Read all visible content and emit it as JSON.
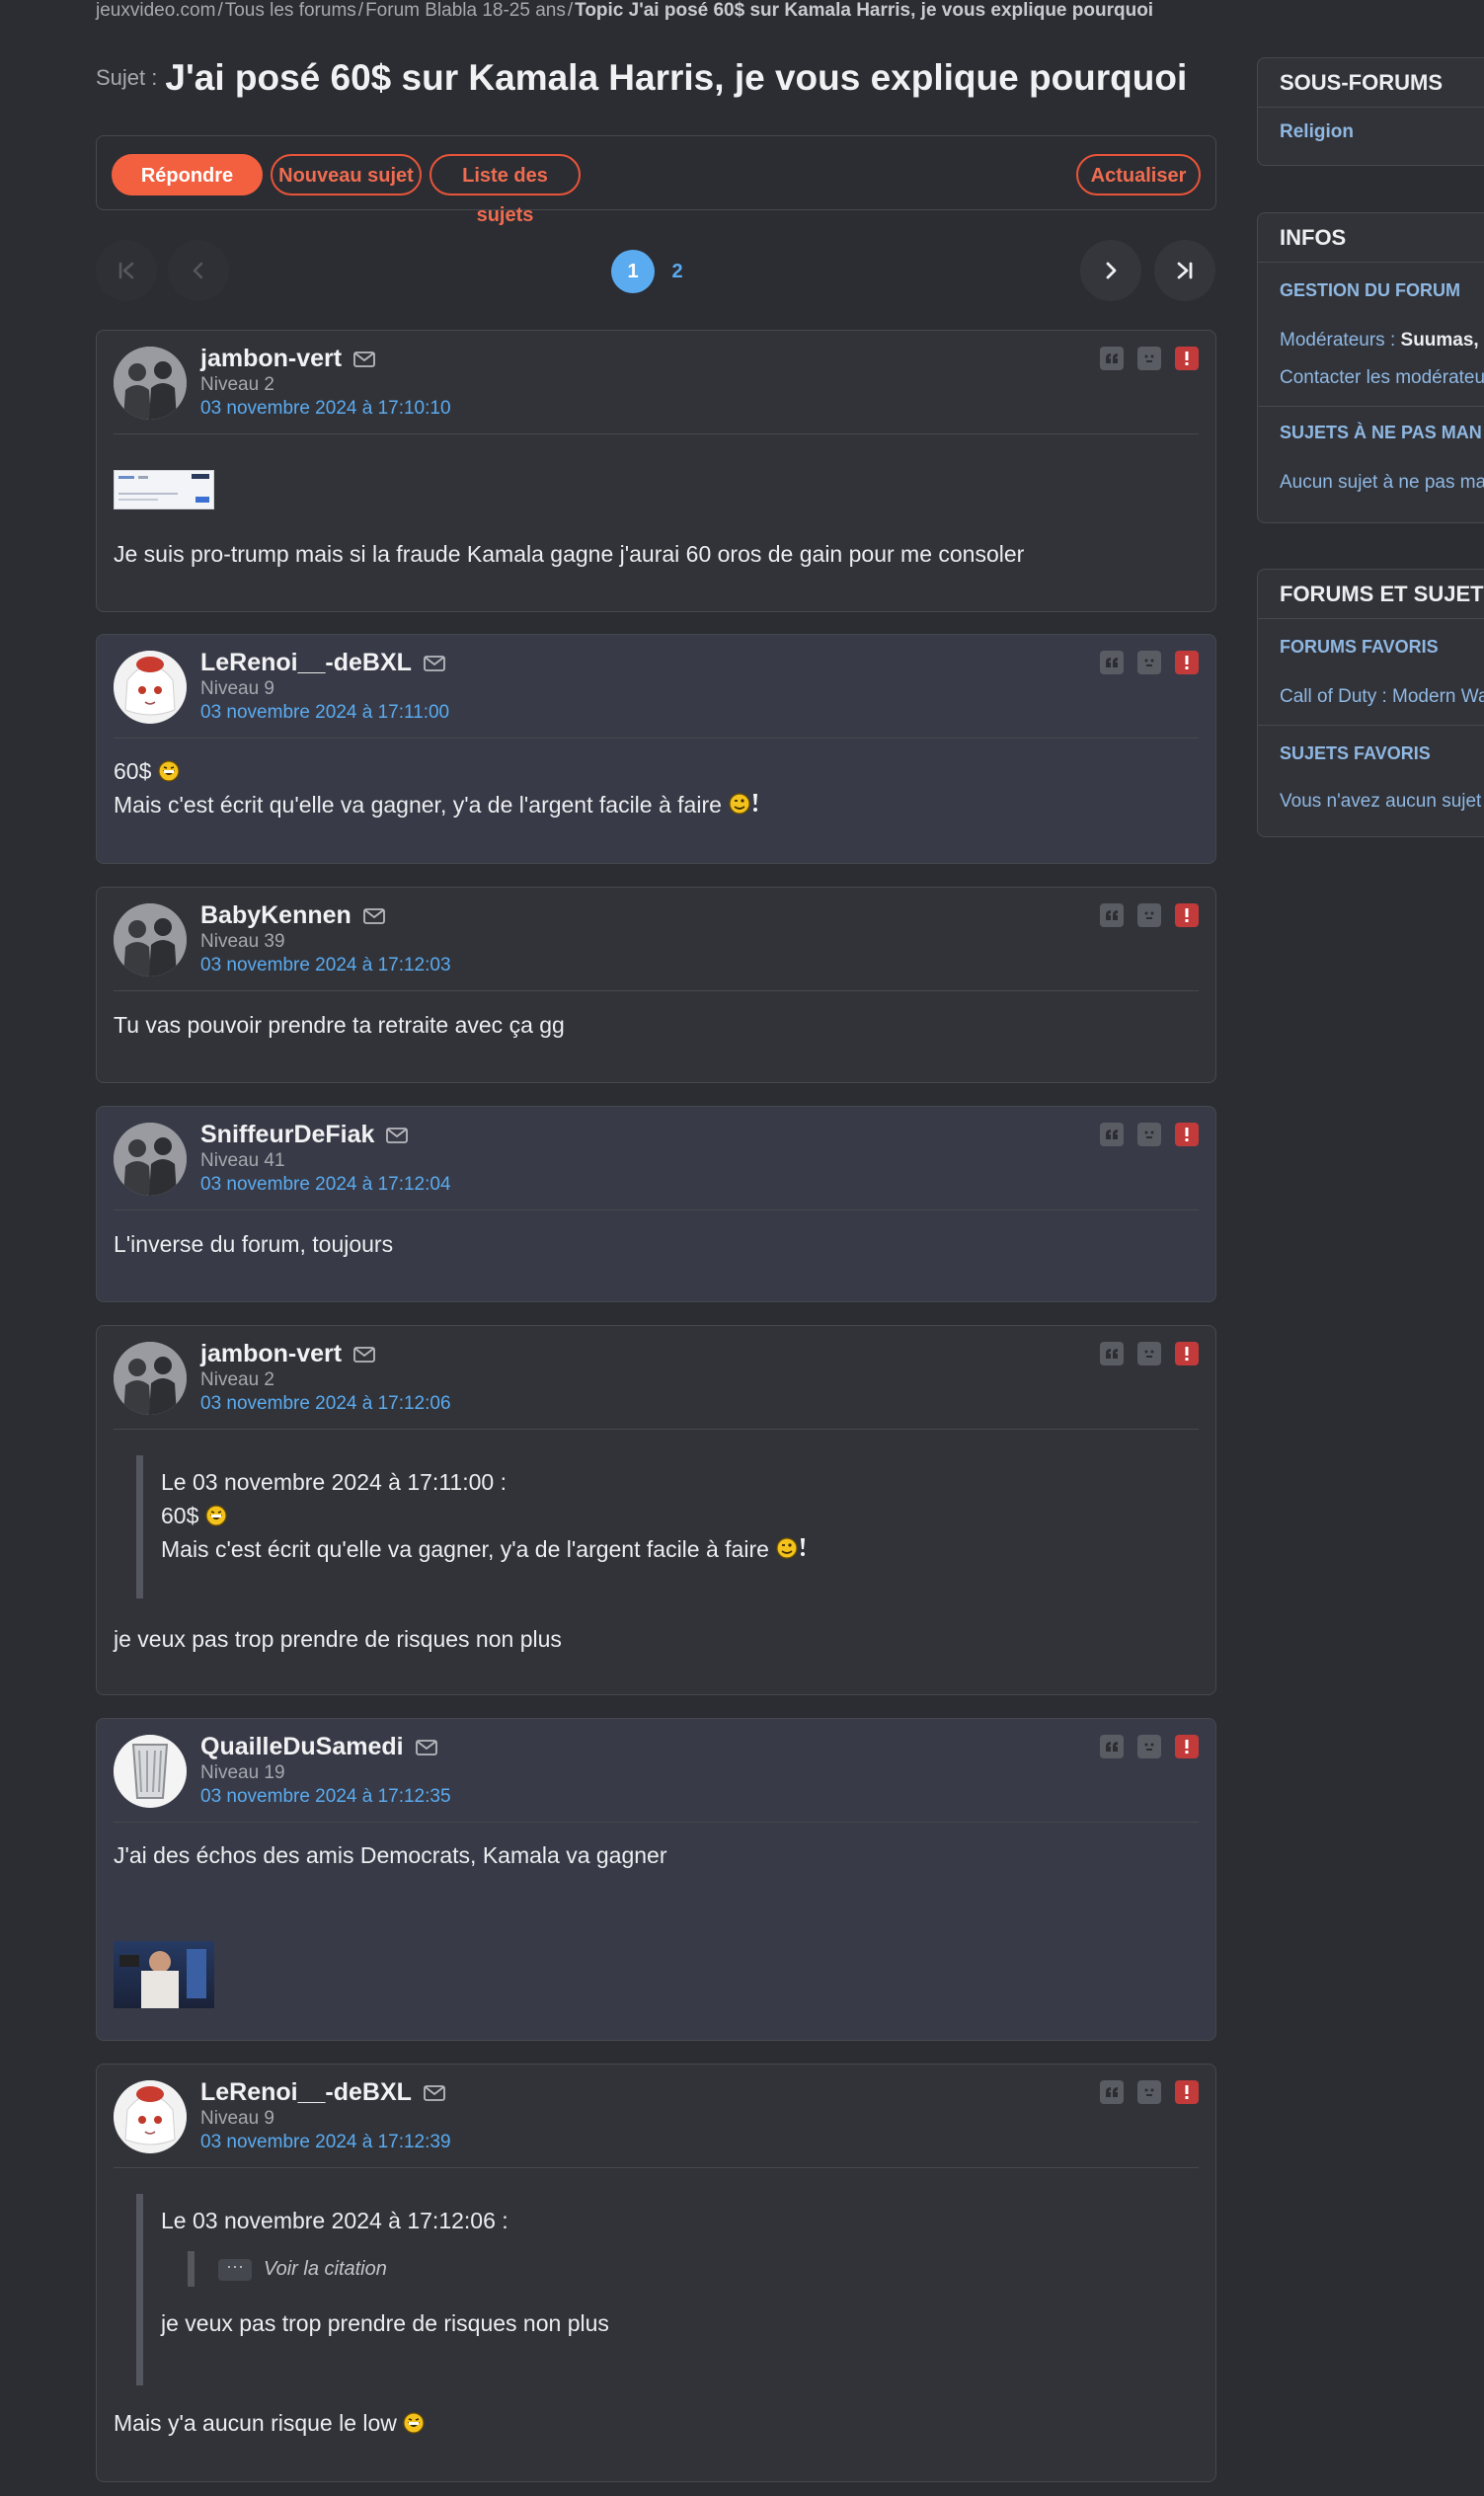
{
  "breadcrumb": {
    "site": "jeuxvideo.com",
    "all_forums": "Tous les forums",
    "forum": "Forum Blabla 18-25 ans",
    "current": "Topic J'ai posé 60$ sur Kamala Harris, je vous explique pourquoi",
    "separator": "/"
  },
  "topic": {
    "prefix": "Sujet :",
    "title": "J'ai posé 60$ sur Kamala Harris, je vous explique pourquoi"
  },
  "actions": {
    "reply": "Répondre",
    "new_topic": "Nouveau sujet",
    "topic_list": "Liste des sujets",
    "refresh": "Actualiser"
  },
  "pagination": {
    "pages": [
      "1",
      "2"
    ],
    "current": "1"
  },
  "posts": [
    {
      "username": "jambon-vert",
      "level": "Niveau 2",
      "date": "03 novembre 2024 à 17:10:10",
      "lines": [
        "Je suis pro-trump mais si la fraude Kamala gagne j'aurai 60 oros de gain pour me consoler"
      ]
    },
    {
      "username": "LeRenoi__-deBXL",
      "level": "Niveau 9",
      "date": "03 novembre 2024 à 17:11:00",
      "lines": [
        "60$",
        "Mais c'est écrit qu'elle va gagner, y'a de l'argent facile à faire"
      ]
    },
    {
      "username": "BabyKennen",
      "level": "Niveau 39",
      "date": "03 novembre 2024 à 17:12:03",
      "lines": [
        "Tu vas pouvoir prendre ta retraite avec ça gg"
      ]
    },
    {
      "username": "SniffeurDeFiak",
      "level": "Niveau 41",
      "date": "03 novembre 2024 à 17:12:04",
      "lines": [
        "L'inverse du forum, toujours"
      ]
    },
    {
      "username": "jambon-vert",
      "level": "Niveau 2",
      "date": "03 novembre 2024 à 17:12:06",
      "quote": [
        "Le 03 novembre 2024 à 17:11:00 :",
        "60$",
        "Mais c'est écrit qu'elle va gagner, y'a de l'argent facile à faire"
      ],
      "lines": [
        "je veux pas trop prendre de risques non plus"
      ]
    },
    {
      "username": "QuailleDuSamedi",
      "level": "Niveau 19",
      "date": "03 novembre 2024 à 17:12:35",
      "lines": [
        "J'ai des échos des amis Democrats, Kamala va gagner"
      ]
    },
    {
      "username": "LeRenoi__-deBXL",
      "level": "Niveau 9",
      "date": "03 novembre 2024 à 17:12:39",
      "quote": [
        "Le 03 novembre 2024 à 17:12:06 :",
        "je veux pas trop prendre de risques non plus"
      ],
      "nested_quote": "Voir la citation",
      "lines": [
        "Mais y'a aucun risque le low"
      ]
    }
  ],
  "sidebar": {
    "subforums": {
      "title": "SOUS-FORUMS",
      "items": [
        "Religion"
      ]
    },
    "infos": {
      "title": "INFOS",
      "management": "GESTION DU FORUM",
      "moderators_label": "Modérateurs :",
      "moderators": "Suumas,",
      "contact": "Contacter les modérateur",
      "dont_miss": "SUJETS À NE PAS MAN",
      "dont_miss_none": "Aucun sujet à ne pas ma"
    },
    "favorites": {
      "title": "FORUMS ET SUJETS",
      "forums_title": "FORUMS FAVORIS",
      "forum_item": "Call of Duty : Modern Wa",
      "topics_title": "SUJETS FAVORIS",
      "topics_none": "Vous n'avez aucun sujet"
    }
  },
  "colors": {
    "accent": "#f3603f",
    "link": "#5aabf0",
    "background": "#2c2d32",
    "post_bg": "#323339",
    "post_bg_alt": "#383b47"
  },
  "icons": [
    "mail-icon",
    "quote-icon",
    "mp-icon",
    "report-icon",
    "first-page-icon",
    "prev-page-icon",
    "next-page-icon",
    "last-page-icon",
    "grin-emoji",
    "wink-emoji"
  ]
}
